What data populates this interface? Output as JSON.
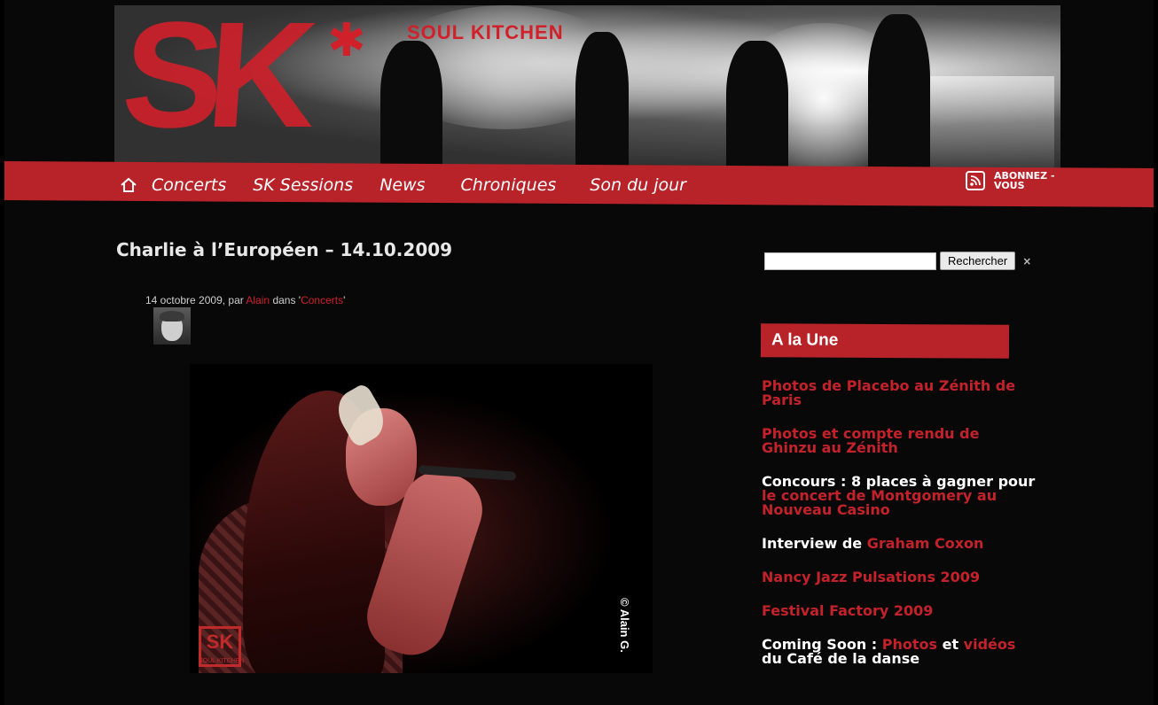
{
  "site": {
    "brand_text": "SOUL KITCHEN",
    "logo_text": "SK"
  },
  "nav": {
    "items": [
      {
        "label": "Concerts"
      },
      {
        "label": "SK Sessions"
      },
      {
        "label": "News"
      },
      {
        "label": "Chroniques"
      },
      {
        "label": "Son du jour"
      }
    ],
    "rss_label": "ABONNEZ -VOUS"
  },
  "post": {
    "title": "Charlie à l’Européen – 14.10.2009",
    "meta_date": "14 octobre 2009, par ",
    "meta_author": "Alain",
    "meta_in": " dans '",
    "meta_category": "Concerts",
    "meta_end": "'",
    "photo_credit": "© Alain G.",
    "photo_watermark": "SK",
    "photo_watermark_text": "SOUL KITCHEN"
  },
  "search": {
    "value": "",
    "button_label": "Rechercher",
    "close_label": "×"
  },
  "sidebar": {
    "widget_title": "A la Une",
    "items": [
      {
        "parts": [
          {
            "text": "Photos de Placebo au Zénith de Paris",
            "red": true
          }
        ]
      },
      {
        "parts": [
          {
            "text": "Photos et compte rendu de Ghinzu au Zénith",
            "red": true
          }
        ]
      },
      {
        "parts": [
          {
            "text": "Concours : 8 places à gagner pour ",
            "red": false
          },
          {
            "text": "le concert de Montgomery au Nouveau Casino",
            "red": true
          }
        ]
      },
      {
        "parts": [
          {
            "text": "Interview de ",
            "red": false
          },
          {
            "text": "Graham Coxon",
            "red": true
          }
        ]
      },
      {
        "parts": [
          {
            "text": "Nancy Jazz Pulsations 2009",
            "red": true
          }
        ]
      },
      {
        "parts": [
          {
            "text": "Festival Factory 2009",
            "red": true
          }
        ]
      },
      {
        "parts": [
          {
            "text": "Coming Soon : ",
            "red": false
          },
          {
            "text": "Photos",
            "red": true
          },
          {
            "text": " et ",
            "red": false
          },
          {
            "text": "vidéos",
            "red": true
          },
          {
            "text": " du Café de la danse",
            "red": false
          }
        ]
      }
    ]
  },
  "colors": {
    "accent": "#b8232a",
    "link": "#c3222b",
    "background": "#080808"
  }
}
